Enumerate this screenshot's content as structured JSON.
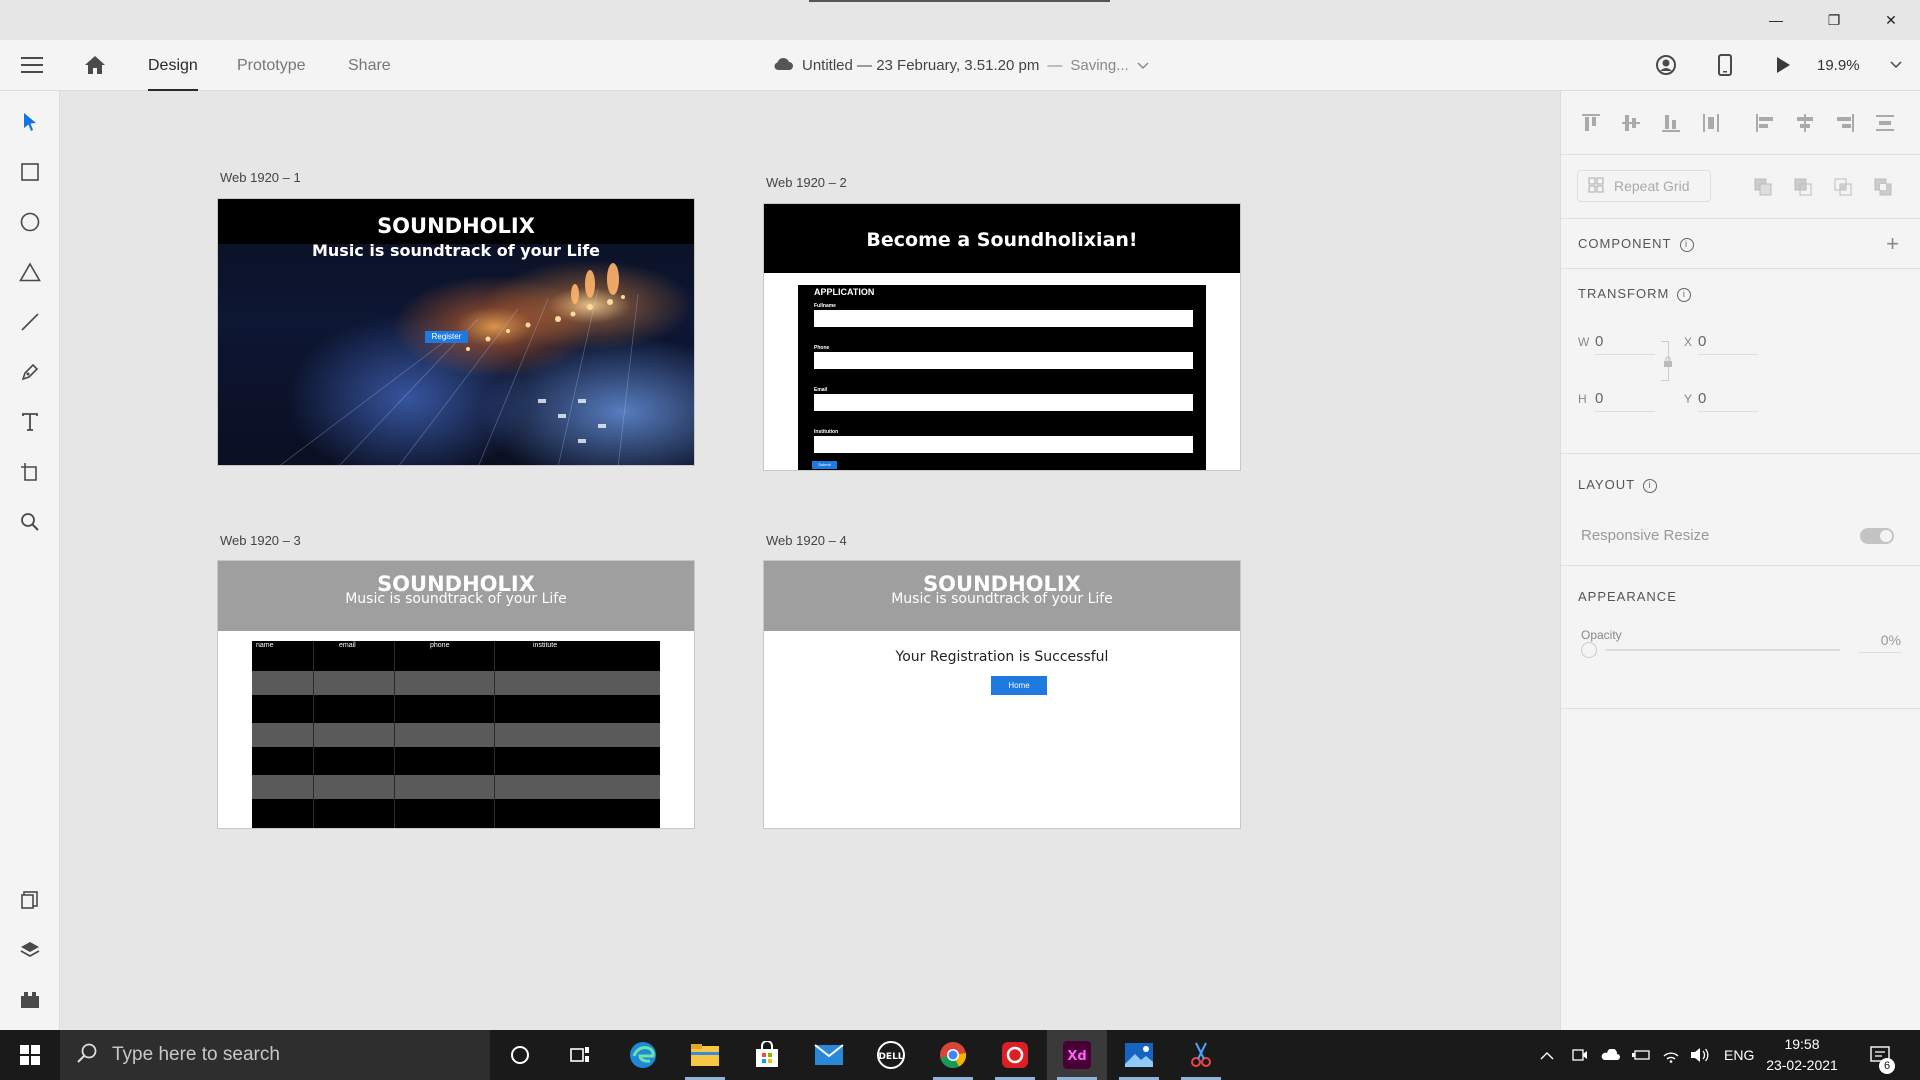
{
  "window": {
    "minimize_glyph": "—",
    "maximize_glyph": "❐",
    "close_glyph": "✕"
  },
  "toolbar": {
    "tabs": [
      "Design",
      "Prototype",
      "Share"
    ],
    "active_tab": "Design",
    "doc_title": "Untitled — 23 February, 3.51.20 pm",
    "doc_separator": "—",
    "saving_status": "Saving...",
    "zoom": "19.9%"
  },
  "left_tools": [
    "select-icon",
    "rectangle-icon",
    "ellipse-icon",
    "polygon-icon",
    "line-icon",
    "pen-icon",
    "text-icon",
    "artboard-icon",
    "zoom-icon"
  ],
  "left_bottom_tools": [
    "assets-icon",
    "layers-icon",
    "plugins-icon"
  ],
  "artboards": {
    "ab1": {
      "label": "Web 1920 – 1",
      "title": "SOUNDHOLIX",
      "subtitle": "Music is soundtrack of your Life",
      "button": "Register"
    },
    "ab2": {
      "label": "Web 1920 – 2",
      "title": "Become a Soundholixian!",
      "form_heading": "APPLICATION",
      "fields": [
        "Fullname",
        "Phone",
        "Email",
        "Institution"
      ],
      "submit": "Submit"
    },
    "ab3": {
      "label": "Web 1920 – 3",
      "title": "SOUNDHOLIX",
      "subtitle": "Music is soundtrack of your Life",
      "columns": [
        "name",
        "email",
        "phone",
        "institute"
      ]
    },
    "ab4": {
      "label": "Web 1920 – 4",
      "title": "SOUNDHOLIX",
      "subtitle": "Music is soundtrack of your Life",
      "message": "Your Registration is Successful",
      "button": "Home"
    }
  },
  "right_panel": {
    "repeat_grid": "Repeat Grid",
    "component": "COMPONENT",
    "transform": "TRANSFORM",
    "w_label": "W",
    "w_value": "0",
    "x_label": "X",
    "x_value": "0",
    "h_label": "H",
    "h_value": "0",
    "y_label": "Y",
    "y_value": "0",
    "layout": "LAYOUT",
    "responsive_resize": "Responsive Resize",
    "responsive_resize_on": true,
    "appearance": "APPEARANCE",
    "opacity_label": "Opacity",
    "opacity_value": "0%"
  },
  "taskbar": {
    "search_placeholder": "Type here to search",
    "apps": [
      "cortana-icon",
      "task-view-icon",
      "edge-icon",
      "file-explorer-icon",
      "store-icon",
      "mail-icon",
      "dell-icon",
      "chrome-icon",
      "creative-cloud-icon",
      "adobe-xd-icon",
      "photos-icon",
      "snip-icon"
    ],
    "language": "ENG",
    "time": "19:58",
    "date": "23-02-2021",
    "notification_count": "6"
  },
  "colors": {
    "accent_blue": "#1f7ae0",
    "xd_purple": "#470137",
    "header_grey": "#9f9f9f"
  }
}
